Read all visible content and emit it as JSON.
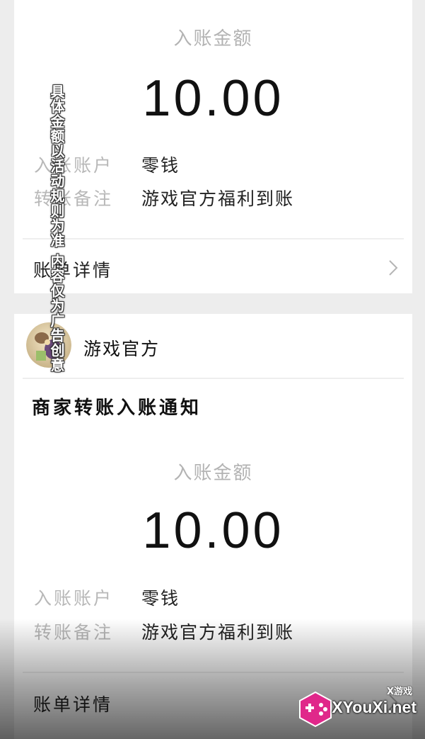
{
  "card1": {
    "amount_label": "入账金额",
    "amount": "10.00",
    "account_label": "入账账户",
    "account_value": "零钱",
    "note_label": "转账备注",
    "note_value": "游戏官方福利到账",
    "bill_details": "账单详情"
  },
  "card2": {
    "sender_name": "游戏官方",
    "notice_title": "商家转账入账通知",
    "amount_label": "入账金额",
    "amount": "10.00",
    "account_label": "入账账户",
    "account_value": "零钱",
    "note_label": "转账备注",
    "note_value": "游戏官方福利到账",
    "bill_details": "账单详情"
  },
  "overlay": {
    "caption": "具体金额以活动规则为准 内容仅为广告创意"
  },
  "watermark": {
    "small": "X游戏",
    "text": "XYouXi.net"
  },
  "colors": {
    "page_bg": "#ededed",
    "card_bg": "#ffffff",
    "muted_text": "#b8b8b8",
    "watermark_accent": "#e0288a"
  },
  "icons": {
    "chevron": "chevron-right-icon",
    "avatar": "game-avatar",
    "watermark_badge": "gamepad-badge-icon"
  }
}
